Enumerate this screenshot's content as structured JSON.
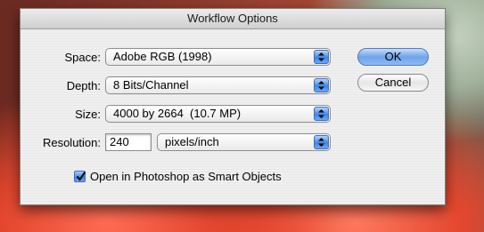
{
  "dialog": {
    "title": "Workflow Options",
    "space": {
      "label": "Space:",
      "value": "Adobe RGB (1998)"
    },
    "depth": {
      "label": "Depth:",
      "value": "8 Bits/Channel"
    },
    "size": {
      "label": "Size:",
      "value": "4000 by 2664  (10.7 MP)"
    },
    "resolution": {
      "label": "Resolution:",
      "value": "240",
      "unit": "pixels/inch"
    },
    "smart_objects": {
      "label": "Open in Photoshop as Smart Objects",
      "checked": true
    },
    "ok_label": "OK",
    "cancel_label": "Cancel"
  },
  "colors": {
    "default_button": "#6ea4ec",
    "popup_arrow": "#3f85e4"
  }
}
